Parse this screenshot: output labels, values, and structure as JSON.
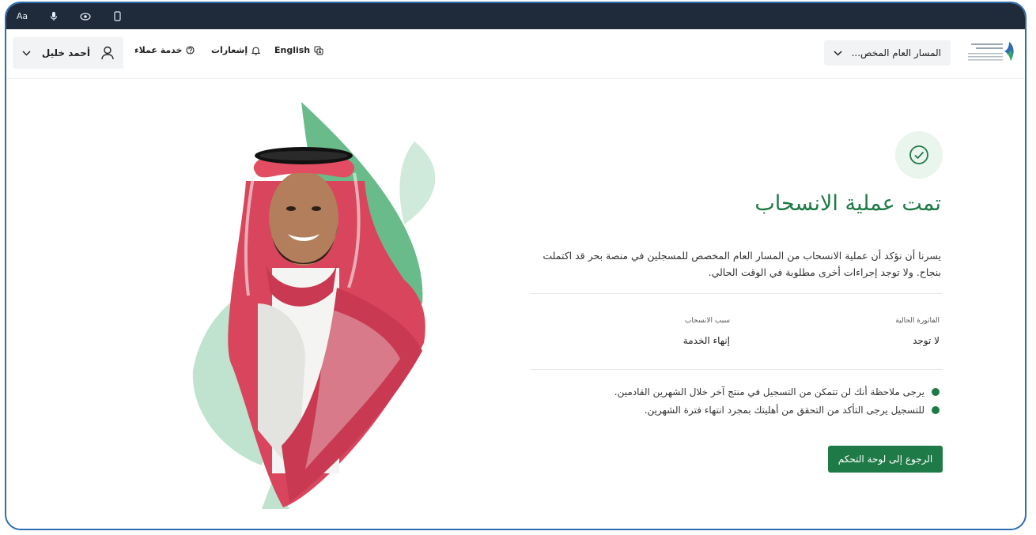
{
  "accessibility_bar": {
    "font_size_label": "Aa",
    "icons": [
      "microphone-icon",
      "eye-icon",
      "mobile-icon"
    ]
  },
  "nav": {
    "user_name": "أحمد خليل",
    "customer_service": "خدمة عملاء",
    "notifications": "إشعارات",
    "language": "English",
    "program_select": "المسار العام المخص..."
  },
  "main": {
    "title": "تمت عملية الانسحاب",
    "description": "يسرنا أن نؤكد أن عملية الانسحاب من المسار العام المخصص للمسجلين في منصة بحر قد اكتملت بنجاح. ولا توجد إجراءات أخرى مطلوبة في الوقت الحالي.",
    "details": {
      "current_invoice_label": "الفاتورة الحالية",
      "current_invoice_value": "لا توجد",
      "withdrawal_reason_label": "سبب الانسحاب",
      "withdrawal_reason_value": "إنهاء الخدمة"
    },
    "notes": [
      "يرجى ملاحظة أنك لن تتمكن من التسجيل في منتج آخر خلال الشهرين القادمين.",
      "للتسجيل يرجى التأكد من التحقق من أهليتك بمجرد انتهاء فترة الشهرين."
    ],
    "back_button": "الرجوع إلى لوحة التحكم"
  },
  "colors": {
    "primary_green": "#1e7a46",
    "top_bar": "#1f2a3a",
    "frame_border": "#2f6db3"
  }
}
